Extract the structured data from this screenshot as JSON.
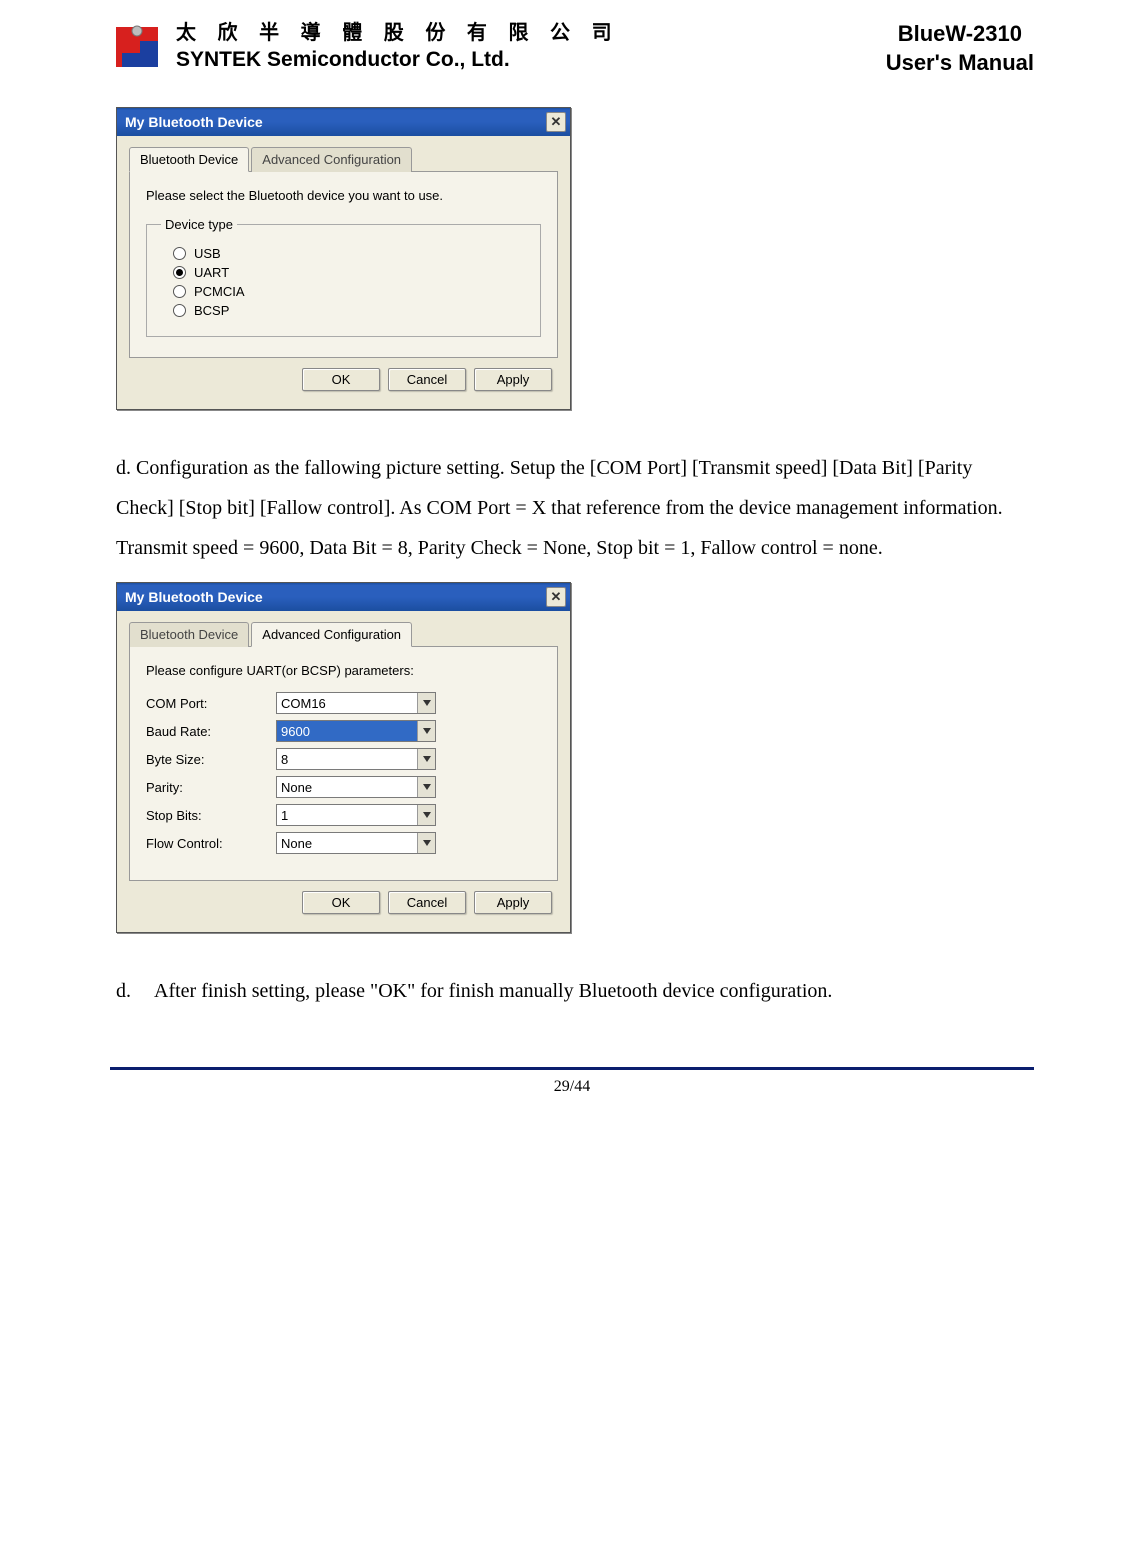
{
  "header": {
    "company_cn": "太 欣 半 導 體 股 份 有 限 公 司",
    "company_en": "SYNTEK Semiconductor Co., Ltd.",
    "product": "BlueW-2310",
    "doc_title": "User's Manual"
  },
  "dialog1": {
    "title": "My Bluetooth Device",
    "close": "✕",
    "tabs": {
      "bt": "Bluetooth Device",
      "adv": "Advanced Configuration"
    },
    "msg": "Please select the Bluetooth device you want to use.",
    "legend": "Device type",
    "options": {
      "usb": "USB",
      "uart": "UART",
      "pcmcia": "PCMCIA",
      "bcsp": "BCSP"
    },
    "buttons": {
      "ok": "OK",
      "cancel": "Cancel",
      "apply": "Apply"
    }
  },
  "para_d": "d. Configuration as the fallowing picture setting. Setup the [COM Port] [Transmit speed] [Data Bit] [Parity Check] [Stop bit] [Fallow control]. As COM Port = X that reference from the device management information. Transmit speed = 9600, Data Bit = 8, Parity Check = None, Stop bit = 1, Fallow control = none.",
  "dialog2": {
    "title": "My Bluetooth Device",
    "close": "✕",
    "tabs": {
      "bt": "Bluetooth Device",
      "adv": "Advanced Configuration"
    },
    "msg": "Please configure UART(or BCSP) parameters:",
    "fields": {
      "com_label": "COM Port:",
      "com_value": "COM16",
      "baud_label": "Baud Rate:",
      "baud_value": "9600",
      "byte_label": "Byte Size:",
      "byte_value": "8",
      "parity_label": "Parity:",
      "parity_value": "None",
      "stop_label": "Stop Bits:",
      "stop_value": "1",
      "flow_label": "Flow Control:",
      "flow_value": "None"
    },
    "buttons": {
      "ok": "OK",
      "cancel": "Cancel",
      "apply": "Apply"
    }
  },
  "list_d2": {
    "marker": "d.",
    "text": "After finish setting, please \"OK\" for finish manually Bluetooth device configuration."
  },
  "page_number": "29/44"
}
